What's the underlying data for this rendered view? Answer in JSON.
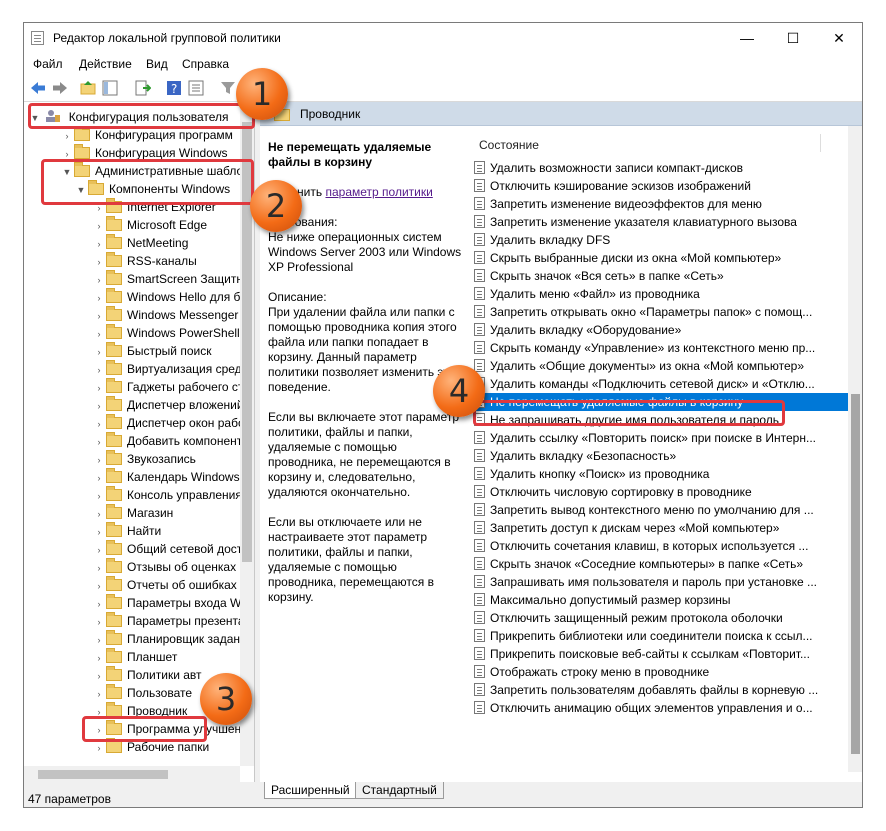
{
  "window": {
    "title": "Редактор локальной групповой политики",
    "minimize_glyph": "—",
    "maximize_glyph": "☐",
    "close_glyph": "✕"
  },
  "menu": [
    "Файл",
    "Действие",
    "Вид",
    "Справка"
  ],
  "toolbar_icons": [
    "back-icon",
    "forward-icon",
    "up-folder-icon",
    "show-hide-tree-icon",
    "export-list-icon",
    "help-icon",
    "properties-icon",
    "filter-icon"
  ],
  "tree": {
    "root_label": "Конфигурация пользователя",
    "items": [
      {
        "label": "Конфигурация программ"
      },
      {
        "label": "Конфигурация Windows"
      },
      {
        "label": "Административные шаблоны"
      },
      {
        "label": "Компоненты Windows"
      },
      {
        "label": "Internet Explorer"
      },
      {
        "label": "Microsoft Edge"
      },
      {
        "label": "NetMeeting"
      },
      {
        "label": "RSS-каналы"
      },
      {
        "label": "SmartScreen Защитни"
      },
      {
        "label": "Windows Hello для б"
      },
      {
        "label": "Windows Messenger"
      },
      {
        "label": "Windows PowerShell"
      },
      {
        "label": "Быстрый поиск"
      },
      {
        "label": "Виртуализация среды"
      },
      {
        "label": "Гаджеты рабочего ст"
      },
      {
        "label": "Диспетчер вложений"
      },
      {
        "label": "Диспетчер окон рабо"
      },
      {
        "label": "Добавить компонент"
      },
      {
        "label": "Звукозапись"
      },
      {
        "label": "Календарь Windows"
      },
      {
        "label": "Консоль управления"
      },
      {
        "label": "Магазин"
      },
      {
        "label": "Найти"
      },
      {
        "label": "Общий сетевой досту"
      },
      {
        "label": "Отзывы об оценках"
      },
      {
        "label": "Отчеты об ошибках"
      },
      {
        "label": "Параметры входа Wi"
      },
      {
        "label": "Параметры презента"
      },
      {
        "label": "Планировщик задан"
      },
      {
        "label": "Планшет"
      },
      {
        "label": "Политики авт"
      },
      {
        "label": "Пользовате"
      },
      {
        "label": "Проводник"
      },
      {
        "label": "Программа улучшения Windo"
      },
      {
        "label": "Рабочие папки"
      }
    ]
  },
  "right_panel": {
    "header": "Проводник",
    "description": {
      "title": "Не перемещать удаляемые файлы в корзину",
      "edit_prefix": "Изменить",
      "edit_link": "параметр политики",
      "requirements_label": "Требования:",
      "requirements_text": "Не ниже операционных систем Windows Server 2003 или Windows XP Professional",
      "description_label": "Описание:",
      "p1": "При удалении файла или папки с помощью проводника копия этого файла или папки попадает в корзину. Данный параметр политики позволяет изменить это поведение.",
      "p2": "Если вы включаете этот параметр политики, файлы и папки, удаляемые с помощью проводника, не перемещаются в корзину и, следовательно, удаляются окончательно.",
      "p3": "Если вы отключаете или не настраиваете этот параметр политики, файлы и папки, удаляемые с помощью проводника, перемещаются в корзину."
    },
    "list_header": "Состояние",
    "items": [
      "Удалить возможности записи компакт-дисков",
      "Отключить кэширование эскизов изображений",
      "Запретить изменение видеоэффектов для меню",
      "Запретить изменение указателя клавиатурного вызова",
      "Удалить вкладку DFS",
      "Скрыть выбранные диски из окна «Мой компьютер»",
      "Скрыть значок «Вся сеть» в папке «Сеть»",
      "Удалить меню «Файл» из проводника",
      "Запретить открывать окно «Параметры папок» с помощ...",
      "Удалить вкладку «Оборудование»",
      "Скрыть команду «Управление» из контекстного меню пр...",
      "Удалить «Общие документы» из окна «Мой компьютер»",
      "Удалить команды «Подключить сетевой диск» и «Отклю...",
      "Не перемещать удаляемые файлы в корзину",
      "Не запрашивать другие имя пользователя и пароль",
      "Удалить ссылку «Повторить поиск» при поиске в Интерн...",
      "Удалить вкладку «Безопасность»",
      "Удалить кнопку «Поиск» из проводника",
      "Отключить числовую сортировку в проводнике",
      "Запретить вывод контекстного меню по умолчанию для ...",
      "Запретить доступ к дискам через «Мой компьютер»",
      "Отключить сочетания клавиш, в которых используется ...",
      "Скрыть значок «Соседние компьютеры» в папке «Сеть»",
      "Запрашивать имя пользователя и пароль при установке ...",
      "Максимально допустимый размер корзины",
      "Отключить защищенный режим протокола оболочки",
      "Прикрепить библиотеки или соединители поиска к ссыл...",
      "Прикрепить поисковые веб-сайты к ссылкам «Повторит...",
      "Отображать строку меню в проводнике",
      "Запретить пользователям добавлять файлы в корневую ...",
      "Отключить анимацию общих элементов управления и о..."
    ],
    "selected_index": 13
  },
  "tabs": [
    "Расширенный",
    "Стандартный"
  ],
  "active_tab": 0,
  "status_text": "47 параметров",
  "callouts": [
    "1",
    "2",
    "3",
    "4"
  ],
  "colors": {
    "selection": "#0078d7",
    "callout_border": "#e0393e",
    "badge": "#f36b16",
    "header_band": "#cfdbe8"
  }
}
